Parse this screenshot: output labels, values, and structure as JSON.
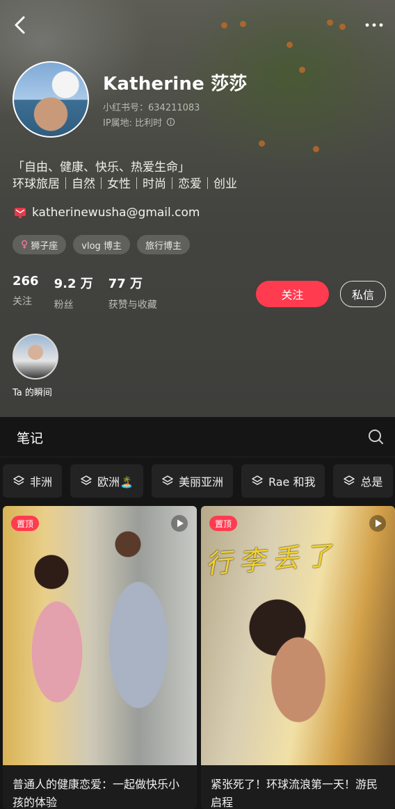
{
  "profile": {
    "name": "Katherine 莎莎",
    "xhs_id": "小红书号：634211083",
    "ip_location": "IP属地: 比利时",
    "bio_line1": "「自由、健康、快乐、热爱生命」",
    "bio_line2": "环球旅居｜自然｜女性｜时尚｜恋爱｜创业",
    "email": "katherinewusha@gmail.com",
    "tags": [
      {
        "label": "狮子座",
        "icon": "female-icon"
      },
      {
        "label": "vlog 博主"
      },
      {
        "label": "旅行博主"
      }
    ]
  },
  "stats": [
    {
      "value": "266",
      "label": "关注"
    },
    {
      "value": "9.2 万",
      "label": "粉丝"
    },
    {
      "value": "77 万",
      "label": "获赞与收藏"
    }
  ],
  "actions": {
    "follow": "关注",
    "message": "私信"
  },
  "moments": {
    "label": "Ta 的瞬间"
  },
  "notes": {
    "title": "笔记",
    "collections": [
      "非洲",
      "欧洲🏝️",
      "美丽亚洲",
      "Rae 和我",
      "总是"
    ],
    "cards": [
      {
        "badge": "置顶",
        "title": "普通人的健康恋爱：一起做快乐小孩的体验",
        "overlay": ""
      },
      {
        "badge": "置顶",
        "title": "紧张死了！环球流浪第一天！游民启程",
        "overlay": "行李丢了"
      }
    ]
  },
  "icons": {
    "back": "chevron-left-icon",
    "more": "more-dots-icon",
    "search": "search-icon",
    "collection": "layers-icon",
    "play": "play-icon",
    "email": "mail-icon"
  },
  "colors": {
    "accent": "#ff3b4f",
    "background": "#151515"
  }
}
